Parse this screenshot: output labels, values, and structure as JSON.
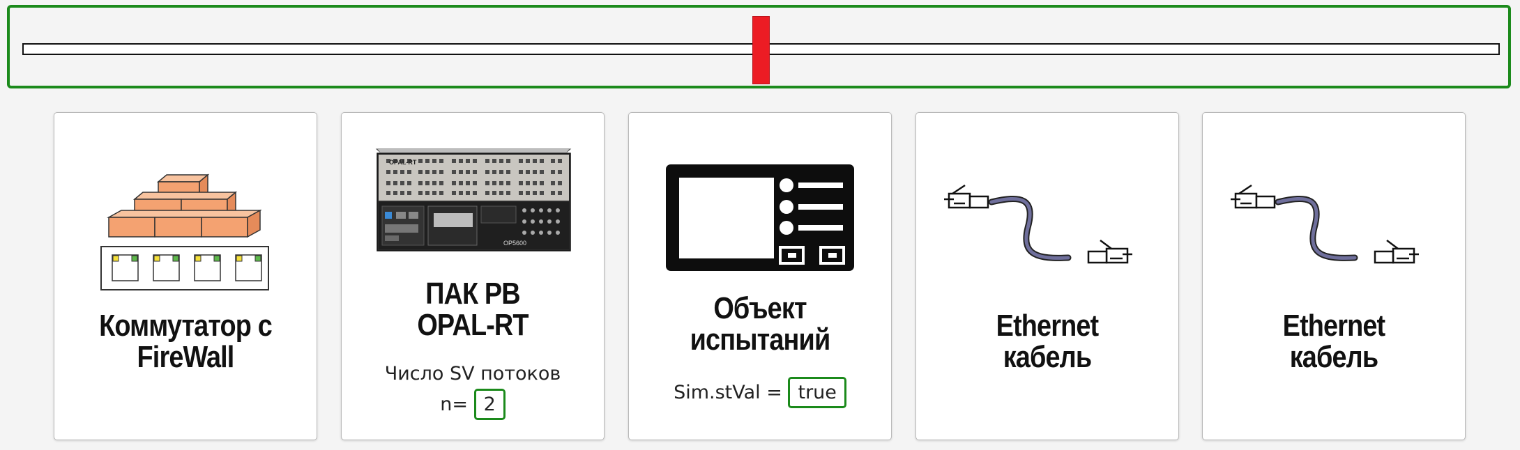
{
  "slider": {
    "value_fraction": 0.5
  },
  "cards": [
    {
      "title": "Коммутатор с\nFireWall"
    },
    {
      "title": "ПАК РВ\nOPAL-RT",
      "subtitle": "Число SV потоков",
      "field_label": "n=",
      "field_value": "2",
      "device_brand": "OPAL-RT",
      "device_model": "OP5600"
    },
    {
      "title": "Объект\nиспытаний",
      "field_label": "Sim.stVal =",
      "field_value": "true"
    },
    {
      "title": "Ethernet\nкабель"
    },
    {
      "title": "Ethernet\nкабель"
    }
  ],
  "colors": {
    "accent_green": "#1b8a1b",
    "thumb_red": "#ec1c24",
    "brick": "#f4a271"
  }
}
